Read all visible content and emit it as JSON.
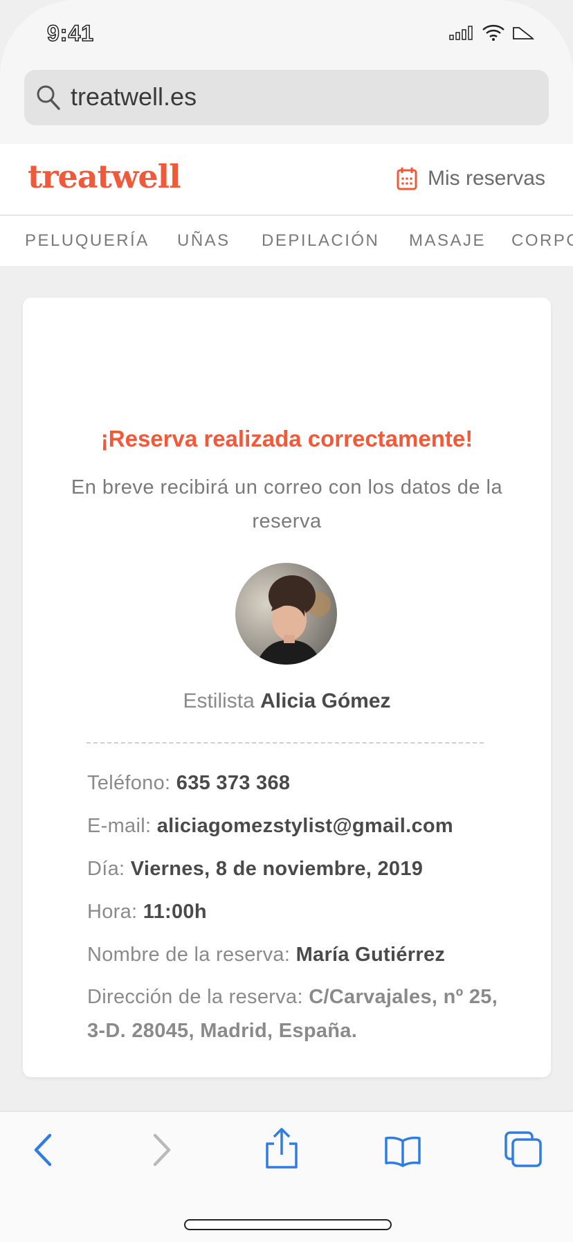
{
  "status_bar": {
    "time": "9:41"
  },
  "browser": {
    "url": "treatwell.es"
  },
  "header": {
    "logo": "treatwell",
    "my_bookings": "Mis reservas"
  },
  "categories": [
    "PELUQUERÍA",
    "UÑAS",
    "DEPILACIÓN",
    "MASAJE",
    "CORPO"
  ],
  "confirmation": {
    "title": "¡Reserva realizada correctamente!",
    "subtitle": "En breve recibirá un correo con los datos de la reserva",
    "stylist_label": "Estilista",
    "stylist_name": "Alicia Gómez"
  },
  "details": {
    "phone_label": "Teléfono:",
    "phone": "635 373 368",
    "email_label": "E-mail:",
    "email": "aliciagomezstylist@gmail.com",
    "day_label": "Día:",
    "day": "Viernes, 8 de noviembre, 2019",
    "time_label": "Hora:",
    "time": "11:00h",
    "name_label": "Nombre de la reserva:",
    "name": "María Gutiérrez",
    "address_label": "Dirección de la reserva:",
    "address": "C/Carvajales, nº 25, 3-D. 28045, Madrid, España."
  },
  "colors": {
    "accent": "#f05a3a",
    "ios_blue": "#2f7de1"
  },
  "icons": [
    "search-icon",
    "calendar-icon",
    "back-icon",
    "forward-icon",
    "share-icon",
    "bookmarks-icon",
    "tabs-icon"
  ]
}
